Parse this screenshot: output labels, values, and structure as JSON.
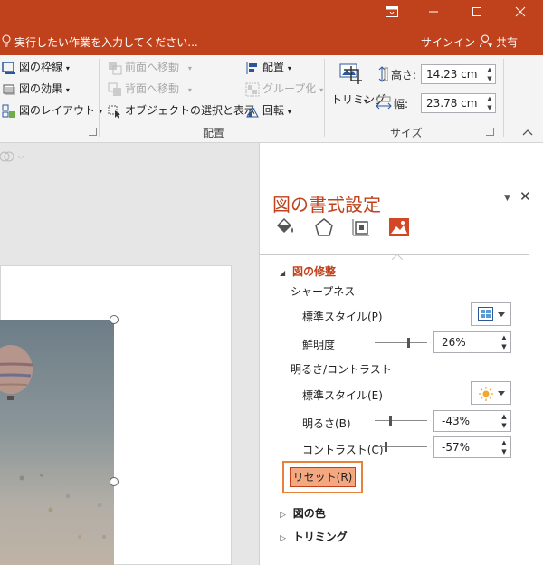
{
  "titlebar": {
    "restore_icon": "ribbon-display-icon",
    "minimize_icon": "minimize-icon",
    "maximize_icon": "maximize-icon",
    "close_icon": "close-icon"
  },
  "tellme": {
    "placeholder": "実行したい作業を入力してください...",
    "signin": "サインイン",
    "share": "共有"
  },
  "ribbon": {
    "picture_styles": {
      "border": "図の枠線",
      "effects": "図の効果",
      "layout": "図のレイアウト"
    },
    "arrange": {
      "bring_forward": "前面へ移動",
      "send_backward": "背面へ移動",
      "selection_pane": "オブジェクトの選択と表示",
      "align": "配置",
      "group": "グループ化",
      "rotate": "回転",
      "group_label": "配置"
    },
    "size": {
      "crop": "トリミング",
      "height_label": "高さ:",
      "height_value": "14.23 cm",
      "width_label": "幅:",
      "width_value": "23.78 cm",
      "group_label": "サイズ"
    }
  },
  "pane": {
    "title": "図の書式設定",
    "tabs": [
      "fill-line-icon",
      "effects-icon",
      "size-properties-icon",
      "picture-icon"
    ],
    "corrections": {
      "header": "図の修整",
      "sharpness_section": "シャープネス",
      "sharp_preset_label": "標準スタイル(P)",
      "sharpness_label": "鮮明度",
      "sharpness_value": "26%",
      "sharpness_level": 0.63,
      "bc_section": "明るさ/コントラスト",
      "bc_preset_label": "標準スタイル(E)",
      "brightness_label": "明るさ(B)",
      "brightness_value": "-43%",
      "brightness_level": 0.285,
      "contrast_label": "コントラスト(C)",
      "contrast_value": "-57%",
      "contrast_level": 0.215,
      "reset": "リセット(R)"
    },
    "color": "図の色",
    "crop": "トリミング"
  },
  "colors": {
    "accent": "#c0421d",
    "highlight": "#f5a880",
    "highlight_border": "#e8823b"
  }
}
